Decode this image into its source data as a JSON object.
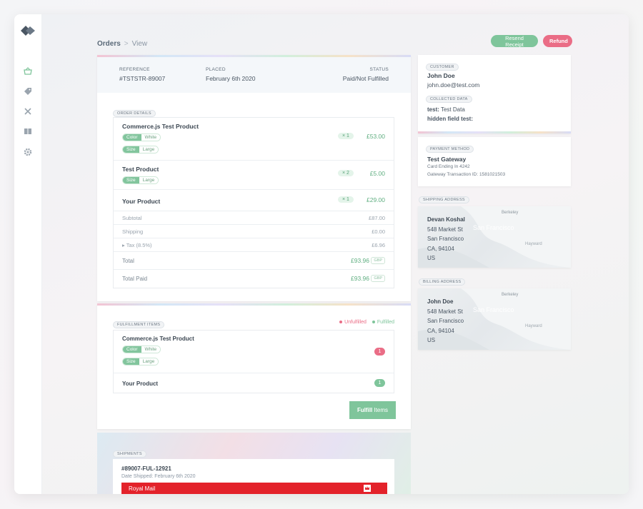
{
  "breadcrumb": {
    "root": "Orders",
    "separator": ">",
    "current": "View"
  },
  "actions": {
    "resend": "Resend Receipt",
    "refund": "Refund"
  },
  "order": {
    "reference_label": "REFERENCE",
    "reference": "#TSTSTR-89007",
    "placed_label": "PLACED",
    "placed": "February 6th 2020",
    "status_label": "STATUS",
    "status": "Paid/Not Fulfilled"
  },
  "order_details": {
    "title": "ORDER DETAILS",
    "items": [
      {
        "name": "Commerce.js Test Product",
        "qty": "× 1",
        "price": "£53.00",
        "options": [
          {
            "key": "Color",
            "value": "White"
          },
          {
            "key": "Size",
            "value": "Large"
          }
        ]
      },
      {
        "name": "Test Product",
        "qty": "× 2",
        "price": "£5.00",
        "options": [
          {
            "key": "Size",
            "value": "Large"
          }
        ]
      },
      {
        "name": "Your Product",
        "qty": "× 1",
        "price": "£29.00",
        "options": []
      }
    ],
    "subtotal_label": "Subtotal",
    "subtotal": "£87.00",
    "shipping_label": "Shipping",
    "shipping": "£0.00",
    "tax_label": "▸ Tax (8.5%)",
    "tax": "£6.96",
    "total_label": "Total",
    "total": "£93.96",
    "total_currency": "GBP",
    "paid_label": "Total Paid",
    "paid": "£93.96",
    "paid_currency": "GBP"
  },
  "fulfillment": {
    "title": "FULFILLMENT ITEMS",
    "legend_unfulfilled": "Unfulfilled",
    "legend_fulfilled": "Fulfilled",
    "items": [
      {
        "name": "Commerce.js Test Product",
        "count": "1",
        "options": [
          {
            "key": "Color",
            "value": "White"
          },
          {
            "key": "Size",
            "value": "Large"
          }
        ]
      },
      {
        "name": "Your Product",
        "count": "1",
        "options": []
      }
    ],
    "button_bold": "Fulfill",
    "button_rest": " Items"
  },
  "shipments": {
    "title": "SHIPMENTS",
    "id": "#89007-FUL-12921",
    "date": "Date Shipped: February 6th 2020",
    "carrier": "Royal Mail"
  },
  "customer": {
    "title": "CUSTOMER",
    "name": "John Doe",
    "email": "john.doe@test.com",
    "collected_title": "COLLECTED DATA",
    "fields": [
      {
        "key": "test:",
        "value": " Test Data"
      },
      {
        "key": "hidden field test:",
        "value": ""
      }
    ]
  },
  "payment": {
    "title": "PAYMENT METHOD",
    "gateway": "Test Gateway",
    "card": "Card Ending In 4242",
    "transaction": "Gateway Transaction ID: 1581021503"
  },
  "shipping_address": {
    "title": "SHIPPING ADDRESS",
    "name": "Devan Koshal",
    "street": "548 Market St",
    "city": "San Francisco",
    "region": "CA, 94104",
    "country": "US"
  },
  "billing_address": {
    "title": "BILLING ADDRESS",
    "name": "John Doe",
    "street": "548 Market St",
    "city": "San Francisco",
    "region": "CA, 94104",
    "country": "US"
  },
  "map_labels": {
    "berkeley": "Berkeley",
    "sf": "San Francisco",
    "hayward": "Hayward"
  },
  "colors": {
    "accent": "#7fc59b",
    "danger": "#ea6d86",
    "royal_mail": "#e3222a"
  }
}
